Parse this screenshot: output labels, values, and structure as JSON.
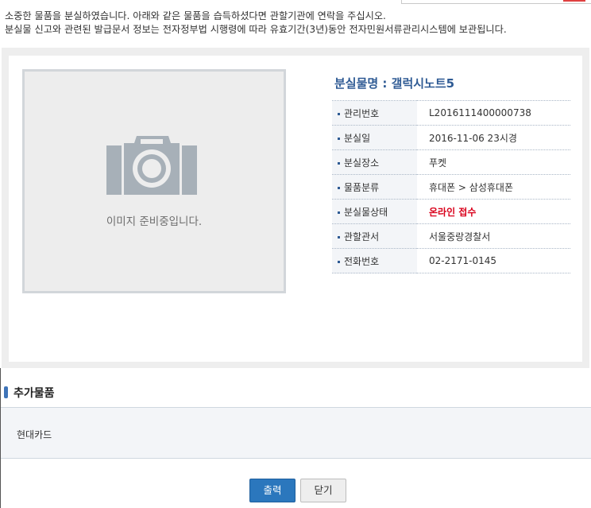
{
  "notice": {
    "line1": "소중한 물품을 분실하였습니다. 아래와 같은 물품을 습득하셨다면 관할기관에 연락을 주십시오.",
    "line2": "분실물 신고와 관련된 발급문서 정보는 전자정부법 시행령에 따라 유효기간(3년)동안 전자민원서류관리시스템에 보관됩니다."
  },
  "photo": {
    "placeholder_text": "이미지 준비중입니다.",
    "icon": "camera-icon"
  },
  "item": {
    "title": "분실물명 : 갤럭시노트5",
    "fields": [
      {
        "label": "관리번호",
        "value": "L2016111400000738"
      },
      {
        "label": "분실일",
        "value": "2016-11-06 23시경"
      },
      {
        "label": "분실장소",
        "value": "푸켓"
      },
      {
        "label": "물품분류",
        "value": "휴대폰 > 삼성휴대폰"
      },
      {
        "label": "분실물상태",
        "value": "온라인 접수"
      },
      {
        "label": "관할관서",
        "value": "서울중랑경찰서"
      },
      {
        "label": "전화번호",
        "value": "02-2171-0145"
      }
    ]
  },
  "extra": {
    "title": "추가물품",
    "content": "현대카드"
  },
  "buttons": {
    "print_label": "출력",
    "close_label": "닫기"
  },
  "colors": {
    "title_blue": "#2f5b94",
    "status_red": "#d9001b",
    "print_button": "#2b77bd"
  }
}
